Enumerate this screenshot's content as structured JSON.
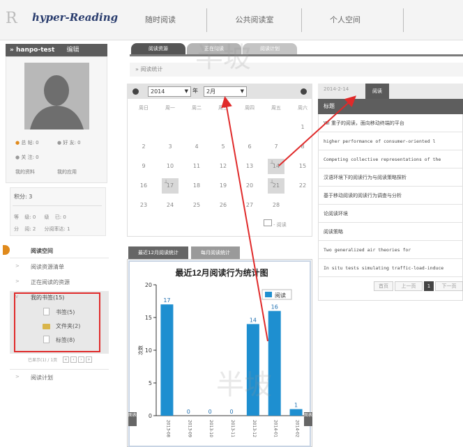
{
  "header": {
    "logo_mark": "R",
    "logo_text": "hyper-Reading",
    "nav": [
      "随时阅读",
      "公共阅读室",
      "个人空间"
    ]
  },
  "user": {
    "name": "hanpo-test",
    "edit_label": "编辑"
  },
  "profile_stats": [
    "总 帖: 0",
    "好 友: 0",
    "关 注: 0",
    "我的资料",
    "我的应用"
  ],
  "score": {
    "title": "积分: 3",
    "rows": [
      [
        "等",
        "级: 0",
        "级",
        "已: 0"
      ],
      [
        "分",
        "阅: 2",
        "分阅率达: 1"
      ]
    ]
  },
  "menu": {
    "active": "阅读空间",
    "items": [
      "阅读资源清单",
      "正在阅读的资源",
      "我的书签(15)",
      "阅读计划"
    ],
    "sub_items": [
      "书签(5)",
      "文件夹(2)",
      "标签(8)"
    ],
    "pager_label": "已显示(1) / 1页"
  },
  "tabs": [
    "阅读资源",
    "正在阅读",
    "阅读计划"
  ],
  "breadcrumb": "» 阅读统计",
  "calendar": {
    "year": "2014",
    "month": "2月",
    "year_suffix": "年",
    "weekdays": [
      "周日",
      "周一",
      "周二",
      "周三",
      "周四",
      "周五",
      "周六"
    ],
    "days": [
      "",
      "",
      "",
      "",
      "",
      "",
      "1",
      "2",
      "3",
      "4",
      "5",
      "6",
      "7",
      "8",
      "9",
      "10",
      "11",
      "12",
      "13",
      "14",
      "15",
      "16",
      "17",
      "18",
      "19",
      "20",
      "21",
      "22",
      "23",
      "24",
      "25",
      "26",
      "27",
      "28",
      ""
    ],
    "highlighted": [
      "14",
      "17",
      "21"
    ],
    "legend": "阅读"
  },
  "chart_tabs": [
    "最近12月阅读统计",
    "每月阅读统计"
  ],
  "chart_data": {
    "type": "bar",
    "title": "最近12月阅读行为统计图",
    "ylabel": "次数",
    "xlabel": "",
    "ylim": [
      0,
      20
    ],
    "yticks": [
      0,
      5,
      10,
      15,
      20
    ],
    "series": [
      {
        "name": "阅读",
        "values": [
          17,
          0,
          0,
          0,
          14,
          16,
          1
        ]
      }
    ],
    "categories": [
      "2013-08",
      "2013-09",
      "2013-10",
      "2013-11",
      "2013-12",
      "2014-01",
      "2014-02"
    ],
    "legend_position": "top-right",
    "grid": false,
    "bar_color": "#1e8fd0"
  },
  "chart_side": {
    "left": "图表",
    "right": "图表"
  },
  "reading": {
    "date": "2014-2-14",
    "tab": "阅读",
    "head": "标题",
    "rows": [
      "Wi 重子的阅读，面向移动终端的平台",
      "higher performance of consumer-oriented l",
      "Competing collective representations of the ",
      "汉语环境下的阅读行为与阅读策略探析",
      "基于移动阅读的阅读行为调查与分析",
      "论阅读环境",
      "阅读策略",
      "Two generalized air theories for",
      "In situ tests simulating traffic-load-induce"
    ],
    "mono_rows": [
      1,
      2,
      7,
      8
    ],
    "pager": [
      "首页",
      "上一页",
      "1",
      "下一页"
    ]
  },
  "watermark": "半坡"
}
